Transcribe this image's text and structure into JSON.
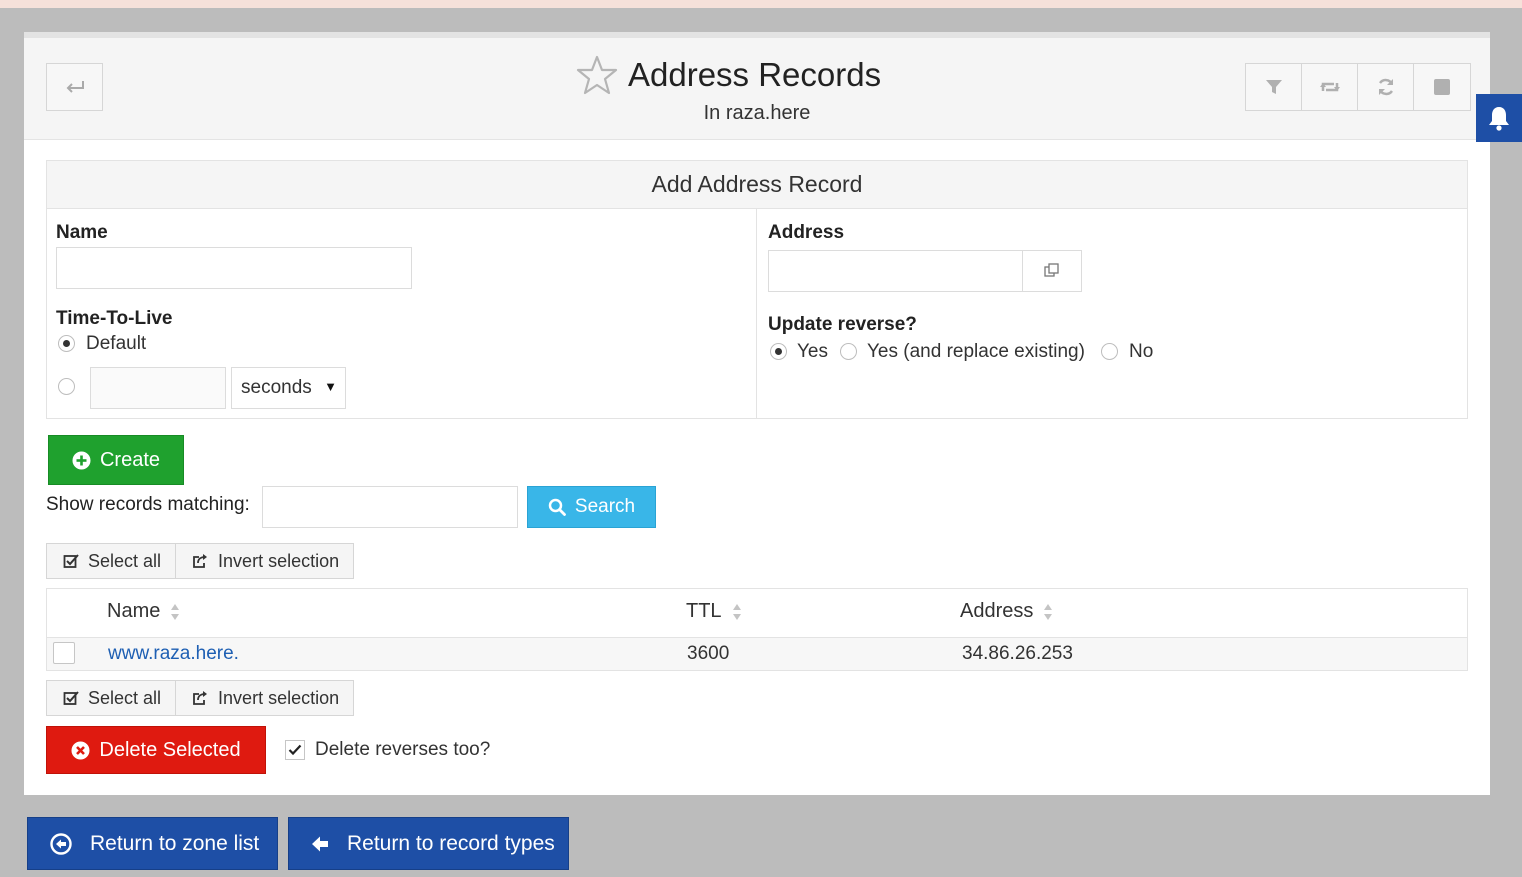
{
  "header": {
    "title": "Address Records",
    "subtitle": "In raza.here",
    "back_icon": "return-arrow-icon",
    "toolbar_icons": [
      "filter-icon",
      "retweet-icon",
      "refresh-icon",
      "stop-icon"
    ]
  },
  "form": {
    "heading": "Add Address Record",
    "name_label": "Name",
    "name_value": "",
    "ttl_label": "Time-To-Live",
    "ttl_default_label": "Default",
    "ttl_value": "",
    "ttl_unit": "seconds",
    "address_label": "Address",
    "address_value": "",
    "update_reverse_label": "Update reverse?",
    "reverse_options": [
      "Yes",
      "Yes (and replace existing)",
      "No"
    ],
    "reverse_selected": "Yes"
  },
  "actions": {
    "create_label": "Create",
    "show_matching_label": "Show records matching:",
    "search_value": "",
    "search_label": "Search",
    "select_all_label": "Select all",
    "invert_selection_label": "Invert selection",
    "delete_selected_label": "Delete Selected",
    "delete_reverses_label": "Delete reverses too?",
    "delete_reverses_checked": true
  },
  "table": {
    "columns": [
      "Name",
      "TTL",
      "Address"
    ],
    "rows": [
      {
        "name": "www.raza.here.",
        "ttl": "3600",
        "address": "34.86.26.253",
        "selected": false
      }
    ]
  },
  "footer": {
    "return_zone_label": "Return to zone list",
    "return_types_label": "Return to record types"
  },
  "colors": {
    "create": "#1fa12e",
    "search": "#39b6e8",
    "delete": "#df1a10",
    "footer_button": "#1e4fa6",
    "link": "#1e5fb3"
  }
}
